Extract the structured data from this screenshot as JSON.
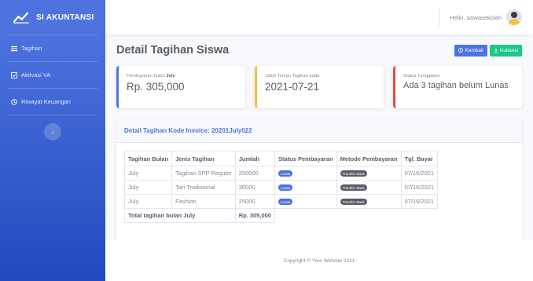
{
  "brand": {
    "name": "SI AKUNTANSI",
    "icon": "chart-line-icon"
  },
  "sidebar": {
    "items": [
      {
        "label": "Tagihan",
        "icon": "list-icon"
      },
      {
        "label": "Aktivasi VA",
        "icon": "check-square-icon"
      },
      {
        "label": "Riwayat Keuangan",
        "icon": "history-icon"
      }
    ],
    "toggle": "‹"
  },
  "topbar": {
    "user_name": "Hello, siswasekolah"
  },
  "page": {
    "title": "Detail Tagihan Siswa",
    "kembali_label": "Kembali",
    "kuitansi_label": "Kuitansi"
  },
  "cards": [
    {
      "label_prefix": "Pembayaran bulan ",
      "label_bold": "July",
      "value": "Rp. 305,000",
      "color": "#4e73df"
    },
    {
      "label_prefix": "Jatuh Tempo Tagihan pada",
      "label_bold": "",
      "value": "2021-07-21",
      "color": "#f6c23e"
    },
    {
      "label_prefix": "Status Tunggakan",
      "label_bold": "",
      "value": "Ada 3 tagihan belum Lunas",
      "color": "#e74a3b"
    }
  ],
  "detail": {
    "header": "Detail Tagihan Kode Invoice: 20201July022",
    "columns": [
      "Tagihan Bulan",
      "Jenis Tagihan",
      "Jumlah",
      "Status Pembayaran",
      "Metode Pembayaran",
      "Tgl. Bayar"
    ],
    "rows": [
      {
        "bulan": "July",
        "jenis": "Tagihan SPP Reguler",
        "jumlah": "250000",
        "status": "Lunas",
        "metode": "Transfer Bank",
        "tgl": "07/16/2021"
      },
      {
        "bulan": "July",
        "jenis": "Tari Tradisional",
        "jumlah": "30000",
        "status": "Lunas",
        "metode": "Transfer Bank",
        "tgl": "07/16/2021"
      },
      {
        "bulan": "July",
        "jenis": "Fashion",
        "jumlah": "25000",
        "status": "Lunas",
        "metode": "Transfer Bank",
        "tgl": "07/16/2021"
      }
    ],
    "total_label": "Total tagihan bulan July",
    "total_value": "Rp. 305,000"
  },
  "footer": {
    "copyright": "Copyright © Your Website 2021"
  }
}
